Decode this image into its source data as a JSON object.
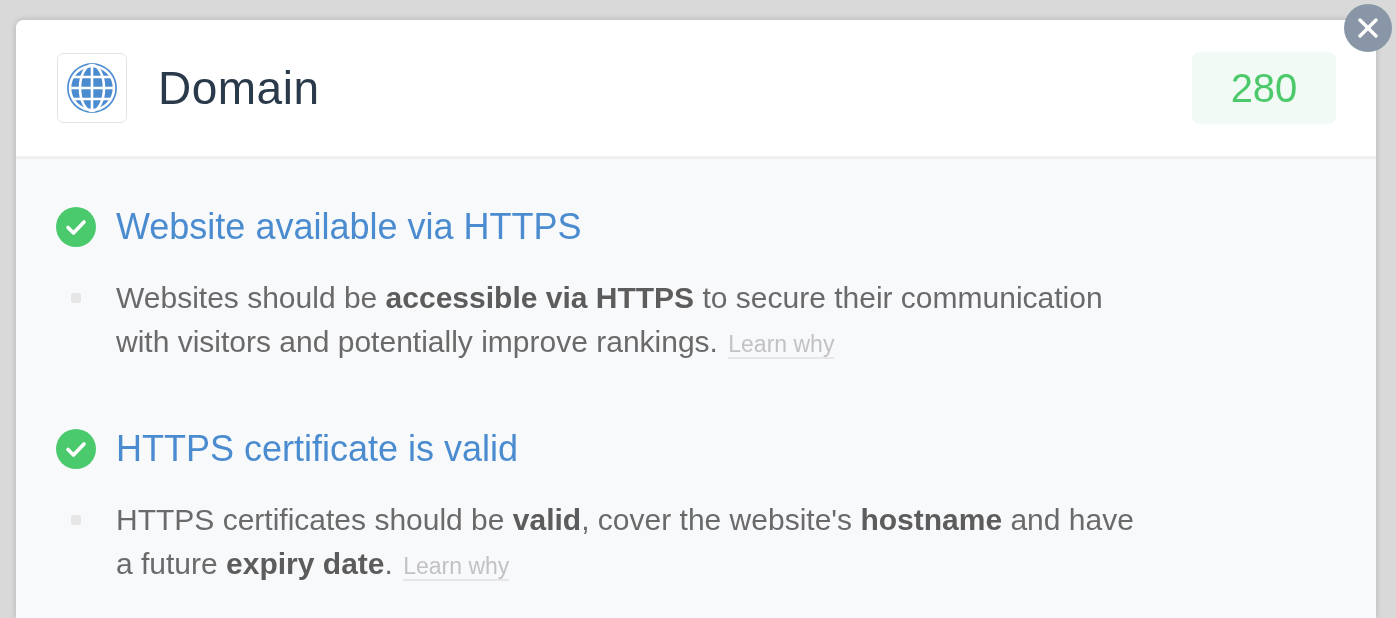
{
  "dialog": {
    "title": "Domain",
    "score": "280"
  },
  "checks": [
    {
      "passed": true,
      "title": "Website available via HTTPS",
      "details": [
        {
          "text": "Websites should be **accessible via HTTPS** to secure their communication with visitors and potentially improve rankings.",
          "link": "Learn why"
        }
      ]
    },
    {
      "passed": true,
      "title": "HTTPS certificate is valid",
      "details": [
        {
          "text": "HTTPS certificates should be **valid**, cover the website's **hostname** and have a future **expiry date**.",
          "link": "Learn why"
        }
      ]
    }
  ]
}
